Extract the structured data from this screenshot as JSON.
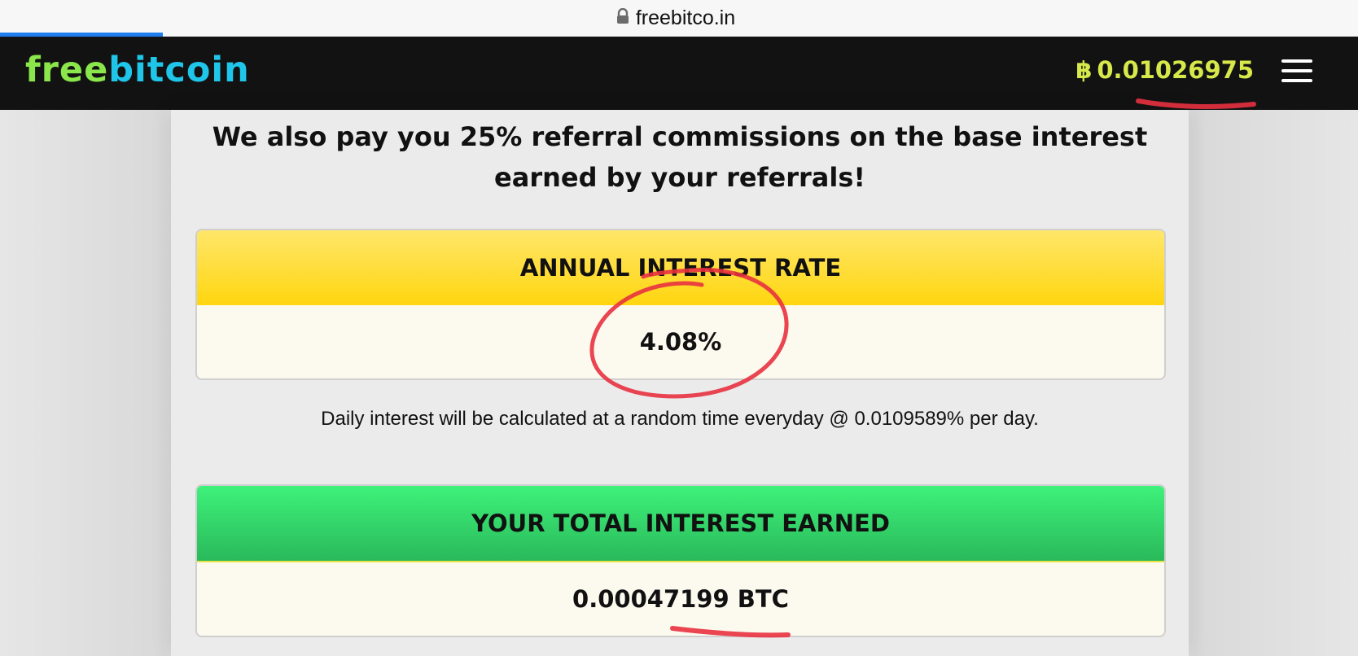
{
  "browser": {
    "url": "freebitco.in",
    "lock_icon": "lock-icon"
  },
  "header": {
    "logo_part1": "free",
    "logo_part2": "bitcoin",
    "balance_symbol": "฿",
    "balance_value": "0.01026975",
    "menu_icon": "hamburger-menu-icon"
  },
  "main": {
    "headline": "We also pay you 25% referral commissions on the base interest earned by your referrals!",
    "annual_rate_title": "ANNUAL INTEREST RATE",
    "annual_rate_value": "4.08%",
    "daily_note": "Daily interest will be calculated at a random time everyday @ 0.0109589% per day.",
    "total_interest_title": "YOUR TOTAL INTEREST EARNED",
    "total_interest_value": "0.00047199 BTC"
  },
  "colors": {
    "header_bg": "#121212",
    "logo_free": "#8ae64b",
    "logo_bitcoin": "#1fc6ea",
    "balance": "#d6e84a",
    "yellow_head": "#ffd60f",
    "green_head": "#2ab95b",
    "annotation_red": "#e8313f"
  }
}
